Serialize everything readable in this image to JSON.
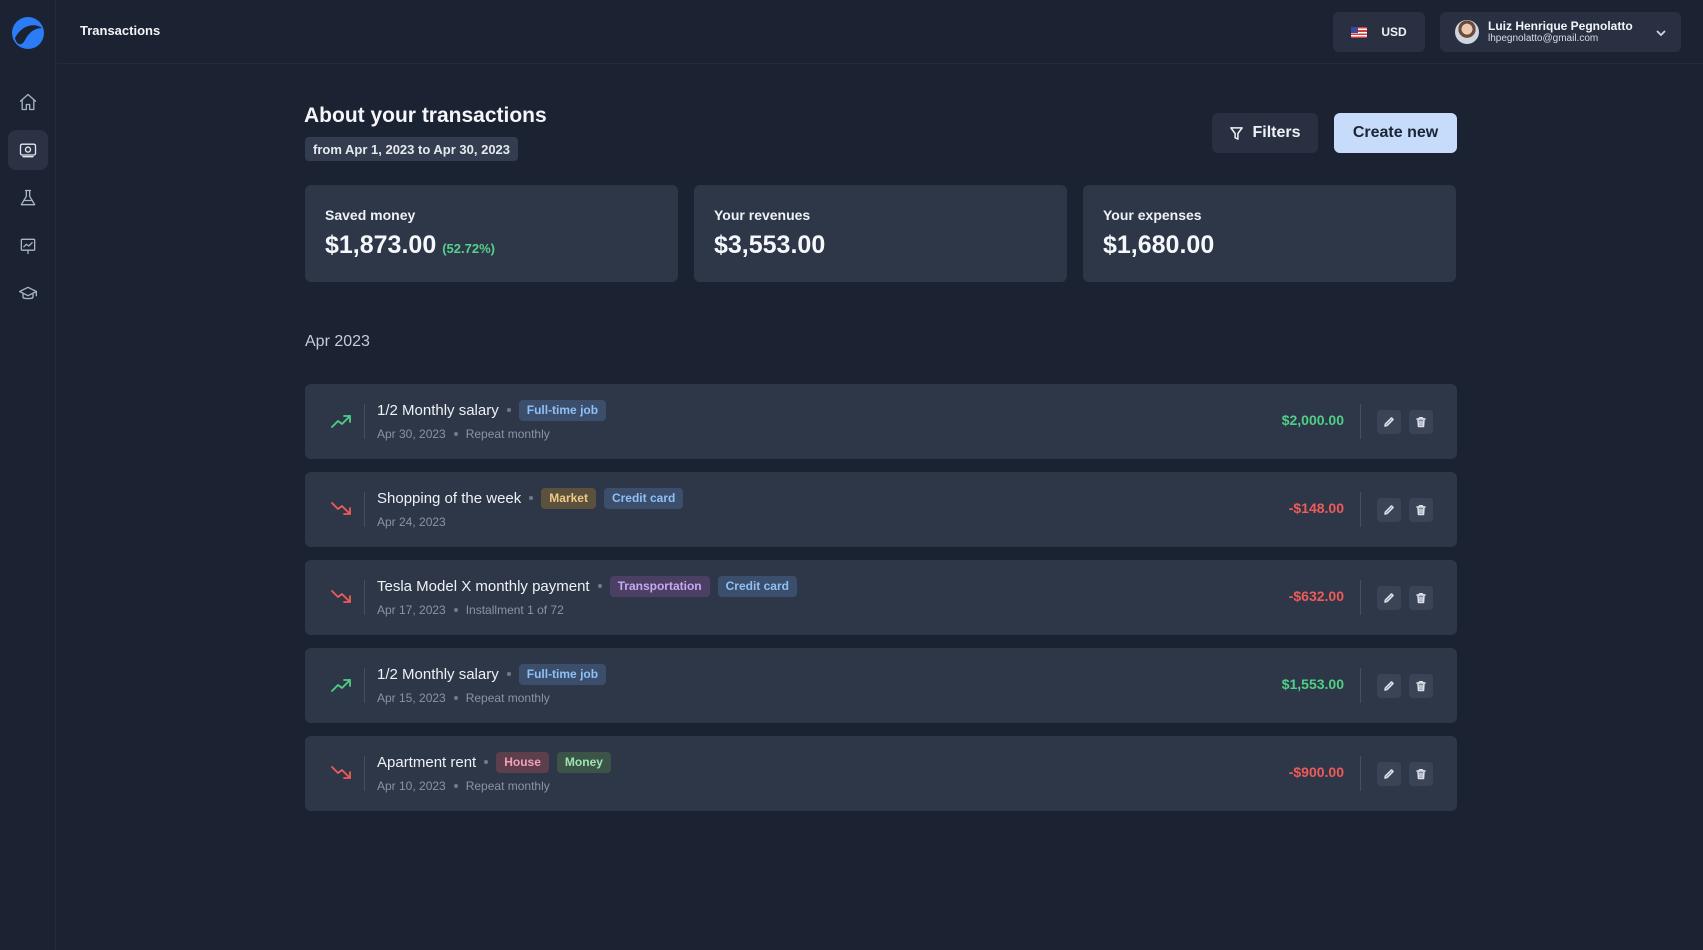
{
  "app": {
    "page_title": "Transactions"
  },
  "sidebar": {
    "items": [
      {
        "icon": "home-icon"
      },
      {
        "icon": "money-icon",
        "active": true
      },
      {
        "icon": "flask-icon"
      },
      {
        "icon": "presentation-chart-icon"
      },
      {
        "icon": "graduation-cap-icon"
      }
    ]
  },
  "header": {
    "currency": "USD",
    "user_name": "Luiz Henrique Pegnolatto",
    "user_email": "lhpegnolatto@gmail.com"
  },
  "main": {
    "heading": "About your transactions",
    "date_range": "from Apr 1, 2023 to Apr 30, 2023",
    "filters_label": "Filters",
    "create_label": "Create new",
    "stats": [
      {
        "label": "Saved money",
        "value": "$1,873.00",
        "percent": "(52.72%)"
      },
      {
        "label": "Your revenues",
        "value": "$3,553.00"
      },
      {
        "label": "Your expenses",
        "value": "$1,680.00"
      }
    ],
    "month_label": "Apr 2023",
    "transactions": [
      {
        "name": "1/2 Monthly salary",
        "trend": "up",
        "tags": [
          {
            "label": "Full-time job",
            "color": "blue"
          }
        ],
        "date": "Apr 30, 2023",
        "note": "Repeat monthly",
        "amount": "$2,000.00"
      },
      {
        "name": "Shopping of the week",
        "trend": "down",
        "tags": [
          {
            "label": "Market",
            "color": "yellow"
          },
          {
            "label": "Credit card",
            "color": "blue"
          }
        ],
        "date": "Apr 24, 2023",
        "note": "",
        "amount": "-$148.00"
      },
      {
        "name": "Tesla Model X monthly payment",
        "trend": "down",
        "tags": [
          {
            "label": "Transportation",
            "color": "purple"
          },
          {
            "label": "Credit card",
            "color": "blue"
          }
        ],
        "date": "Apr 17, 2023",
        "note": "Installment 1 of 72",
        "amount": "-$632.00"
      },
      {
        "name": "1/2 Monthly salary",
        "trend": "up",
        "tags": [
          {
            "label": "Full-time job",
            "color": "blue"
          }
        ],
        "date": "Apr 15, 2023",
        "note": "Repeat monthly",
        "amount": "$1,553.00"
      },
      {
        "name": "Apartment rent",
        "trend": "down",
        "tags": [
          {
            "label": "House",
            "color": "pink"
          },
          {
            "label": "Money",
            "color": "green"
          }
        ],
        "date": "Apr 10, 2023",
        "note": "Repeat monthly",
        "amount": "-$900.00"
      }
    ]
  },
  "colors": {
    "background": "#1b2231",
    "card": "#2e3748",
    "positive": "#4fcf86",
    "negative": "#ef5a5a",
    "accent_button": "#c7dcfb"
  }
}
